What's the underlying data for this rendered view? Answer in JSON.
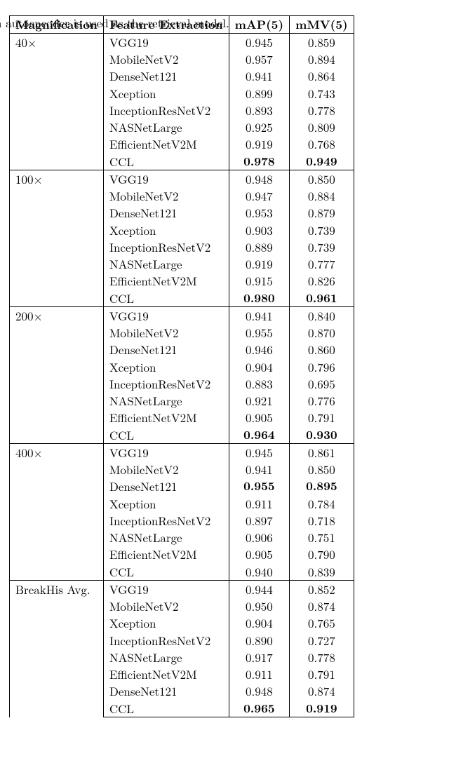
{
  "caption_fragment": "aph autoencoder is used as the retrieval model.",
  "columns": [
    "Magnification",
    "Feature Extraction",
    "mAP(5)",
    "mMV(5)"
  ],
  "groups": [
    {
      "magnification": "40×",
      "rows": [
        {
          "feature": "VGG19",
          "map": "0.945",
          "mmv": "0.859"
        },
        {
          "feature": "MobileNetV2",
          "map": "0.957",
          "mmv": "0.894"
        },
        {
          "feature": "DenseNet121",
          "map": "0.941",
          "mmv": "0.864"
        },
        {
          "feature": "Xception",
          "map": "0.899",
          "mmv": "0.743"
        },
        {
          "feature": "InceptionResNetV2",
          "map": "0.893",
          "mmv": "0.778"
        },
        {
          "feature": "NASNetLarge",
          "map": "0.925",
          "mmv": "0.809"
        },
        {
          "feature": "EfficientNetV2M",
          "map": "0.919",
          "mmv": "0.768"
        },
        {
          "feature": "CCL",
          "map": "0.978",
          "mmv": "0.949",
          "map_bold": true,
          "mmv_bold": true
        }
      ]
    },
    {
      "magnification": "100×",
      "rows": [
        {
          "feature": "VGG19",
          "map": "0.948",
          "mmv": "0.850"
        },
        {
          "feature": "MobileNetV2",
          "map": "0.947",
          "mmv": "0.884"
        },
        {
          "feature": "DenseNet121",
          "map": "0.953",
          "mmv": "0.879"
        },
        {
          "feature": "Xception",
          "map": "0.903",
          "mmv": "0.739"
        },
        {
          "feature": "InceptionResNetV2",
          "map": "0.889",
          "mmv": "0.739"
        },
        {
          "feature": "NASNetLarge",
          "map": "0.919",
          "mmv": "0.777"
        },
        {
          "feature": "EfficientNetV2M",
          "map": "0.915",
          "mmv": "0.826"
        },
        {
          "feature": "CCL",
          "map": "0.980",
          "mmv": "0.961",
          "map_bold": true,
          "mmv_bold": true
        }
      ]
    },
    {
      "magnification": "200×",
      "rows": [
        {
          "feature": "VGG19",
          "map": "0.941",
          "mmv": "0.840"
        },
        {
          "feature": "MobileNetV2",
          "map": "0.955",
          "mmv": "0.870"
        },
        {
          "feature": "DenseNet121",
          "map": "0.946",
          "mmv": "0.860"
        },
        {
          "feature": "Xception",
          "map": "0.904",
          "mmv": "0.796"
        },
        {
          "feature": "InceptionResNetV2",
          "map": "0.883",
          "mmv": "0.695"
        },
        {
          "feature": "NASNetLarge",
          "map": "0.921",
          "mmv": "0.776"
        },
        {
          "feature": "EfficientNetV2M",
          "map": "0.905",
          "mmv": "0.791"
        },
        {
          "feature": "CCL",
          "map": "0.964",
          "mmv": "0.930",
          "map_bold": true,
          "mmv_bold": true
        }
      ]
    },
    {
      "magnification": "400×",
      "rows": [
        {
          "feature": "VGG19",
          "map": "0.945",
          "mmv": "0.861"
        },
        {
          "feature": "MobileNetV2",
          "map": "0.941",
          "mmv": "0.850"
        },
        {
          "feature": "DenseNet121",
          "map": "0.955",
          "mmv": "0.895",
          "map_bold": true,
          "mmv_bold": true
        },
        {
          "feature": "Xception",
          "map": "0.911",
          "mmv": "0.784"
        },
        {
          "feature": "InceptionResNetV2",
          "map": "0.897",
          "mmv": "0.718"
        },
        {
          "feature": "NASNetLarge",
          "map": "0.906",
          "mmv": "0.751"
        },
        {
          "feature": "EfficientNetV2M",
          "map": "0.905",
          "mmv": "0.790"
        },
        {
          "feature": "CCL",
          "map": "0.940",
          "mmv": "0.839"
        }
      ]
    },
    {
      "magnification": "BreakHis Avg.",
      "rows": [
        {
          "feature": "VGG19",
          "map": "0.944",
          "mmv": "0.852"
        },
        {
          "feature": "MobileNetV2",
          "map": "0.950",
          "mmv": "0.874"
        },
        {
          "feature": "Xception",
          "map": "0.904",
          "mmv": "0.765"
        },
        {
          "feature": "InceptionResNetV2",
          "map": "0.890",
          "mmv": "0.727"
        },
        {
          "feature": "NASNetLarge",
          "map": "0.917",
          "mmv": "0.778"
        },
        {
          "feature": "EfficientNetV2M",
          "map": "0.911",
          "mmv": "0.791"
        },
        {
          "feature": "DenseNet121",
          "map": "0.948",
          "mmv": "0.874"
        },
        {
          "feature": "CCL",
          "map": "0.965",
          "mmv": "0.919",
          "map_bold": true,
          "mmv_bold": true
        }
      ]
    }
  ]
}
